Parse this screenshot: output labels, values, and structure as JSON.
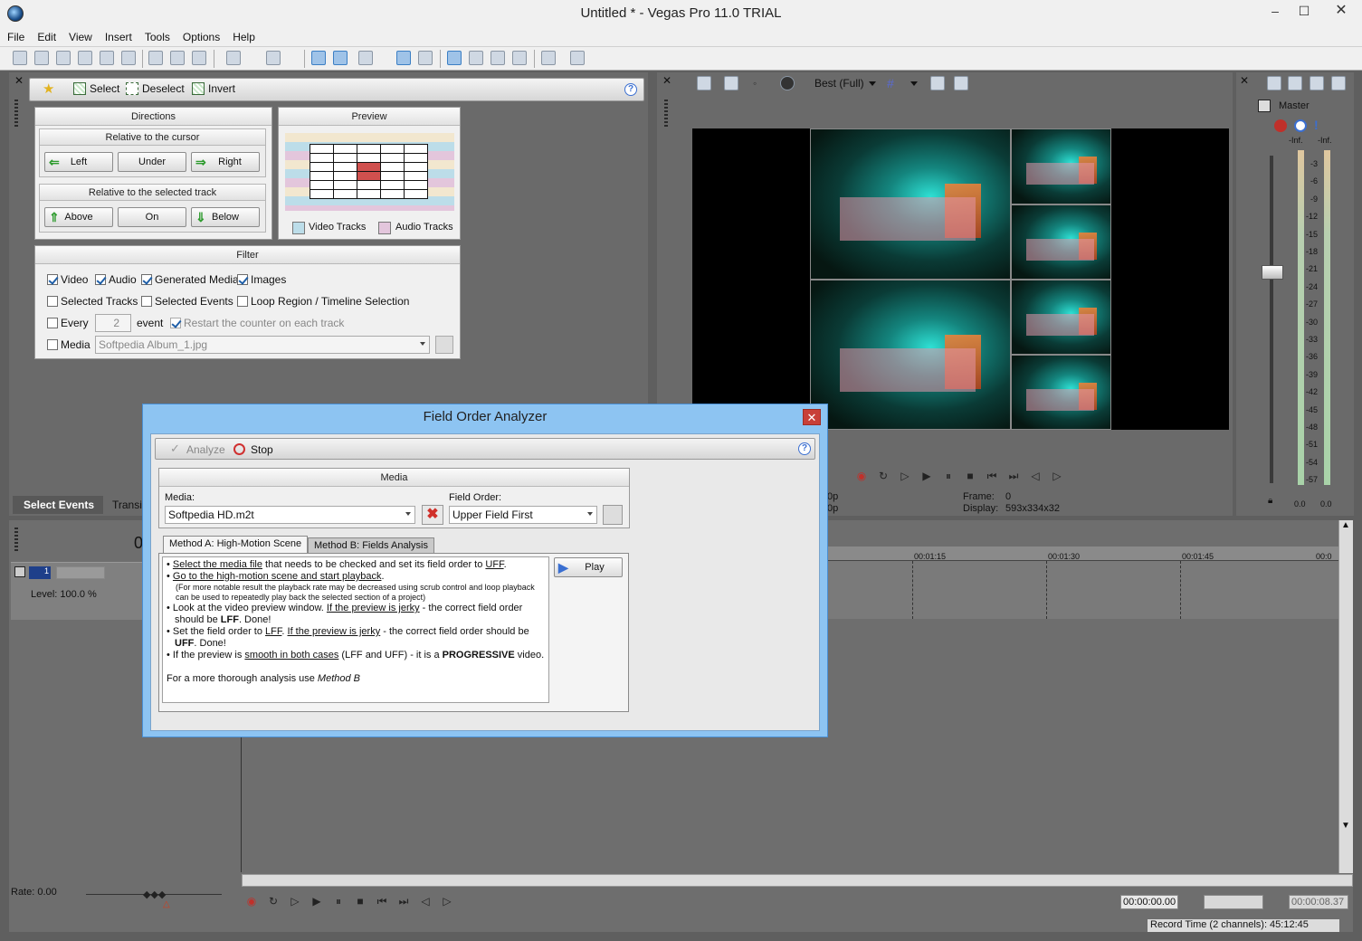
{
  "window": {
    "title": "Untitled * - Vegas Pro 11.0 TRIAL",
    "min": "–",
    "max": "☐",
    "close": "✕"
  },
  "menu": [
    "File",
    "Edit",
    "View",
    "Insert",
    "Tools",
    "Options",
    "Help"
  ],
  "select_events": {
    "toolbar": {
      "select": "Select",
      "deselect": "Deselect",
      "invert": "Invert",
      "help": "?"
    },
    "directions": {
      "title": "Directions",
      "relative_cursor": "Relative to the cursor",
      "left": "Left",
      "under": "Under",
      "right": "Right",
      "relative_track": "Relative to the selected track",
      "above": "Above",
      "on": "On",
      "below": "Below"
    },
    "preview": {
      "title": "Preview",
      "video_tracks": "Video Tracks",
      "audio_tracks": "Audio Tracks"
    },
    "filter": {
      "title": "Filter",
      "video": "Video",
      "audio": "Audio",
      "generated_media": "Generated Media",
      "images": "Images",
      "selected_tracks": "Selected Tracks",
      "selected_events": "Selected Events",
      "loop_region": "Loop Region / Timeline Selection",
      "every": "Every",
      "every_value": "2",
      "event": "event",
      "restart": "Restart the counter on each track",
      "media": "Media",
      "media_value": "Softpedia Album_1.jpg"
    },
    "tabs": {
      "select_events": "Select Events",
      "transitions": "Transi"
    }
  },
  "preview_window": {
    "quality": "Best (Full)",
    "frame_label": "Frame:",
    "frame_value": "0",
    "display_label": "Display:",
    "display_value": "593x334x32",
    "left_clip_1": "0p",
    "left_clip_2": "0p"
  },
  "mixer": {
    "master": "Master",
    "inf_left": "-Inf.",
    "inf_right": "-Inf.",
    "ticks": [
      "3",
      "6",
      "9",
      "12",
      "15",
      "18",
      "21",
      "24",
      "27",
      "30",
      "33",
      "36",
      "39",
      "42",
      "45",
      "48",
      "51",
      "54",
      "57"
    ],
    "val_left": "0.0",
    "val_right": "0.0"
  },
  "timeline": {
    "level": "Level: 100.0 %",
    "track_number": "1",
    "rate": "Rate: 0.00",
    "ruler": [
      "00:01:15",
      "00:01:30",
      "00:01:45",
      "00:0"
    ],
    "time_cursor": "00:00:00.00",
    "time_end": "00:00:08.37",
    "record_time": "Record Time (2 channels): 45:12:45",
    "overlay_left": "0"
  },
  "dialog": {
    "title": "Field Order Analyzer",
    "close": "✕",
    "toolbar": {
      "analyze": "Analyze",
      "stop": "Stop",
      "help": "?"
    },
    "media_group": {
      "title": "Media",
      "media_label": "Media:",
      "media_value": "Softpedia HD.m2t",
      "field_order_label": "Field Order:",
      "field_order_value": "Upper Field First"
    },
    "tabs": {
      "method_a": "Method A: High-Motion Scene",
      "method_b": "Method B: Fields Analysis"
    },
    "play": "Play",
    "instructions": {
      "l1a": "Select the media file",
      "l1b": " that needs to be checked and set its field order to ",
      "l1c": "UFF",
      "l2": "Go to the high-motion scene and start playback",
      "note1": "(For more notable result the playback rate may be decreased using scrub control and loop playback",
      "note2": "can be used to repeatedly play back the selected section of a project)",
      "l3a": "Look at the video preview window. ",
      "l3b": "If the preview is jerky",
      "l3c": " - the correct field order",
      "l3d": "should be ",
      "l3e": "LFF",
      ". Done!": "",
      "l3f": ". Done!",
      "l4a": "Set the field order to ",
      "l4b": "LFF",
      "l4c": ". ",
      "l4d": "If the preview is jerky",
      "l4e": " - the correct field order should be",
      "l4f": "UFF",
      "l4g": ". Done!",
      "l5a": "If the preview is ",
      "l5b": "smooth in both cases",
      "l5c": " (LFF and UFF) - it is a ",
      "l5d": "PROGRESSIVE",
      "l5e": " video.",
      "footer_a": "For a more thorough analysis use ",
      "footer_b": "Method B"
    }
  }
}
